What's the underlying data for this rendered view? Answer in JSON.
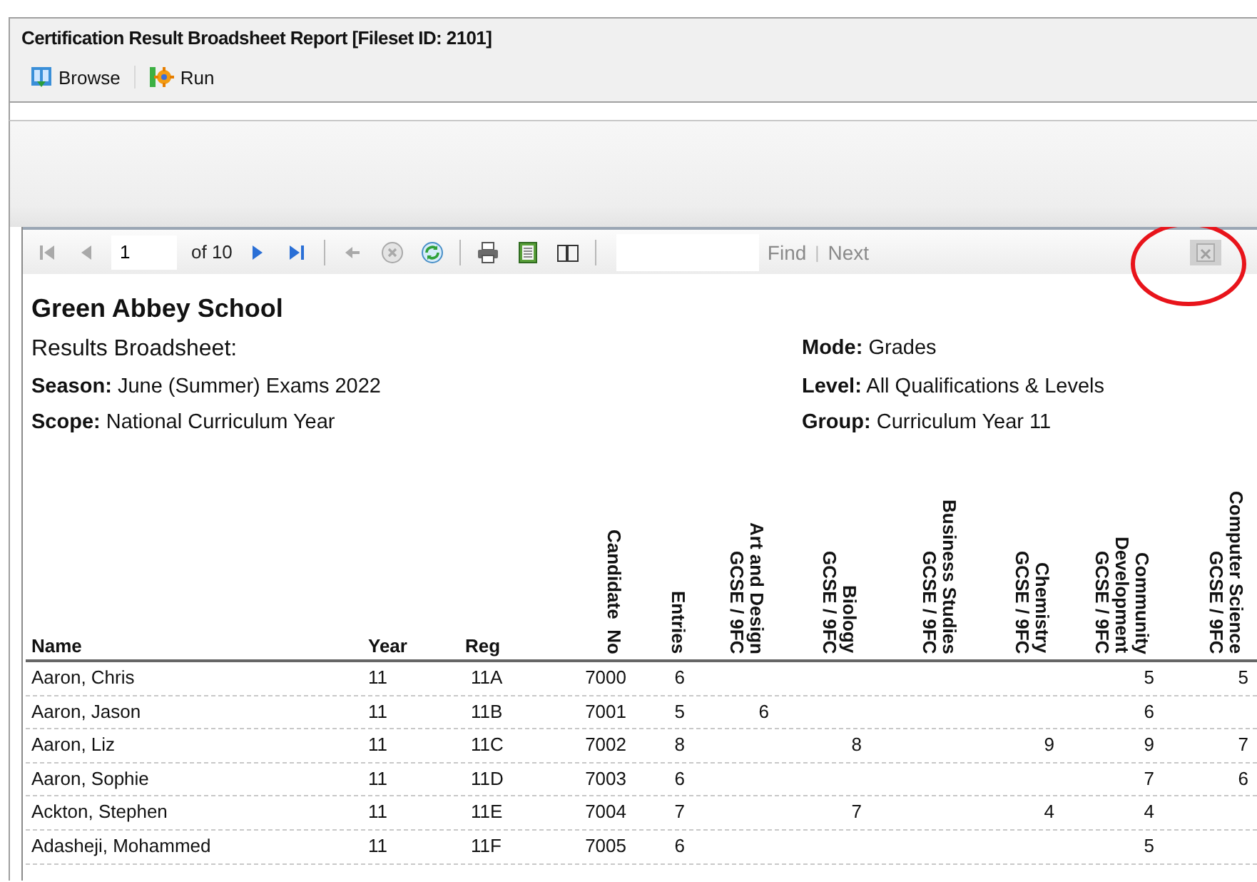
{
  "window": {
    "title": "Certification Result Broadsheet Report [Fileset ID: 2101]"
  },
  "toolbar": [
    {
      "kind": "browse",
      "label": "Browse"
    },
    {
      "kind": "run",
      "label": "Run"
    }
  ],
  "viewer_toolbar": [
    {
      "kind": "first",
      "disabled": true
    },
    {
      "kind": "previous",
      "disabled": true
    },
    {
      "kind": "page_field",
      "value": "1"
    },
    {
      "kind": "text",
      "label": "of 10"
    },
    {
      "kind": "next",
      "disabled": false
    },
    {
      "kind": "last",
      "disabled": false
    },
    {
      "kind": "separator"
    },
    {
      "kind": "back",
      "disabled": true
    },
    {
      "kind": "stop",
      "disabled": true
    },
    {
      "kind": "refresh"
    },
    {
      "kind": "separator"
    },
    {
      "kind": "print"
    },
    {
      "kind": "layout"
    },
    {
      "kind": "page_setup"
    },
    {
      "kind": "separator"
    },
    {
      "kind": "find_field"
    },
    {
      "kind": "link",
      "label": "Find",
      "disabled": true
    },
    {
      "kind": "divider_text",
      "label": "|"
    },
    {
      "kind": "link",
      "label": "Next",
      "disabled": true
    },
    {
      "kind": "spacer"
    },
    {
      "kind": "export",
      "disabled": true
    }
  ],
  "report": {
    "school": "Green Abbey School",
    "title": "Results Broadsheet:",
    "left_fields": [
      {
        "label": "Season:",
        "value": "June (Summer) Exams 2022"
      },
      {
        "label": "Scope:",
        "value": "National Curriculum Year"
      }
    ],
    "right_fields": [
      {
        "label": "Mode:",
        "value": "Grades"
      },
      {
        "label": "Level:",
        "value": "All Qualifications & Levels"
      },
      {
        "label": "Group:",
        "value": "Curriculum Year 11"
      }
    ]
  },
  "table": {
    "columns": [
      {
        "kind": "horizontal",
        "label": "Name"
      },
      {
        "kind": "horizontal",
        "label": "Year"
      },
      {
        "kind": "horizontal",
        "label": "Reg"
      },
      {
        "kind": "vertical",
        "lines": [
          "Candidate  No"
        ]
      },
      {
        "kind": "vertical",
        "lines": [
          "Entries"
        ]
      },
      {
        "kind": "vertical",
        "lines": [
          "Art and Design",
          "GCSE / 9FC"
        ]
      },
      {
        "kind": "vertical",
        "lines": [
          "Biology",
          "GCSE / 9FC"
        ]
      },
      {
        "kind": "vertical",
        "lines": [
          "Business Studies",
          "GCSE / 9FC"
        ]
      },
      {
        "kind": "vertical",
        "lines": [
          "Chemistry",
          "GCSE / 9FC"
        ]
      },
      {
        "kind": "vertical",
        "lines": [
          "Community",
          "Development",
          "GCSE / 9FC"
        ]
      },
      {
        "kind": "vertical",
        "lines": [
          "Computer Science",
          "GCSE / 9FC"
        ]
      }
    ],
    "rows": [
      [
        "Aaron, Chris",
        "11",
        "11A",
        "7000",
        "6",
        null,
        null,
        null,
        null,
        "5",
        "5"
      ],
      [
        "Aaron, Jason",
        "11",
        "11B",
        "7001",
        "5",
        "6",
        null,
        null,
        null,
        "6",
        null
      ],
      [
        "Aaron, Liz",
        "11",
        "11C",
        "7002",
        "8",
        null,
        "8",
        null,
        "9",
        "9",
        "7"
      ],
      [
        "Aaron, Sophie",
        "11",
        "11D",
        "7003",
        "6",
        null,
        null,
        null,
        null,
        "7",
        "6"
      ],
      [
        "Ackton, Stephen",
        "11",
        "11E",
        "7004",
        "7",
        null,
        "7",
        null,
        "4",
        "4",
        null
      ],
      [
        "Adasheji, Mohammed",
        "11",
        "11F",
        "7005",
        "6",
        null,
        null,
        null,
        null,
        "5",
        null
      ]
    ]
  }
}
